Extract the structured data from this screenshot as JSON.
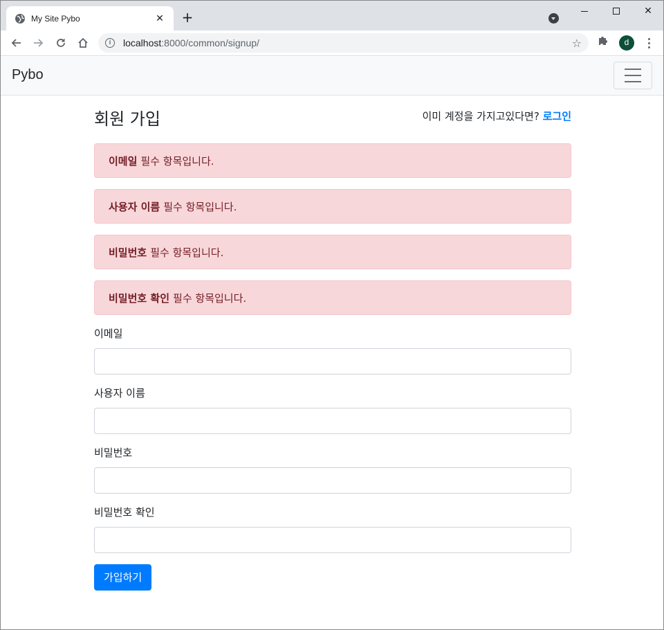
{
  "browser": {
    "tab_title": "My Site Pybo",
    "url_host": "localhost",
    "url_path": ":8000/common/signup/",
    "profile_initial": "d"
  },
  "navbar": {
    "brand": "Pybo"
  },
  "page": {
    "title": "회원 가입",
    "login_prompt": "이미 계정을 가지고있다면?",
    "login_link": "로그인"
  },
  "alerts": [
    {
      "field": "이메일",
      "message": "필수 항목입니다."
    },
    {
      "field": "사용자 이름",
      "message": "필수 항목입니다."
    },
    {
      "field": "비밀번호",
      "message": "필수 항목입니다."
    },
    {
      "field": "비밀번호 확인",
      "message": "필수 항목입니다."
    }
  ],
  "form": {
    "email_label": "이메일",
    "username_label": "사용자 이름",
    "password_label": "비밀번호",
    "password_confirm_label": "비밀번호 확인",
    "submit_label": "가입하기"
  },
  "colors": {
    "primary": "#007bff",
    "alert_bg": "#f8d7da",
    "alert_text": "#721c24"
  }
}
